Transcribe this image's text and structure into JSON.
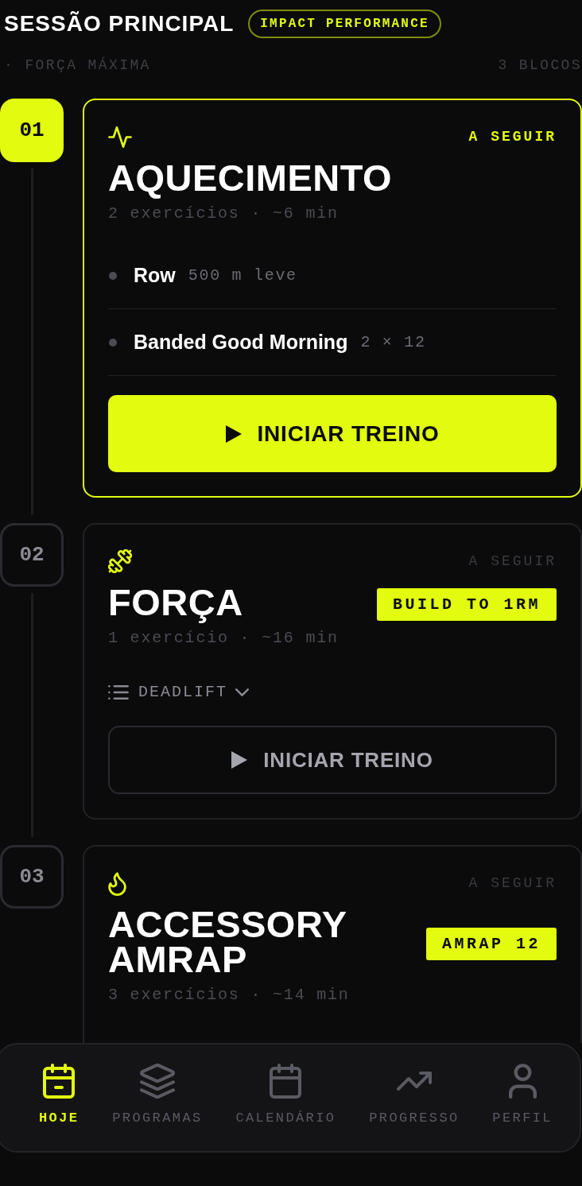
{
  "header": {
    "title": "SESSÃO PRINCIPAL",
    "chip": "IMPACT PERFORMANCE",
    "focus": "· FORÇA MÁXIMA",
    "block_count": "3 BLOCOS"
  },
  "blocks": [
    {
      "number": "01",
      "active": true,
      "status": "A SEGUIR",
      "title": "AQUECIMENTO",
      "meta": "2 exercícios · ~6 min",
      "exercises": [
        {
          "name": "Row",
          "detail": "500 m leve"
        },
        {
          "name": "Banded Good Morning",
          "detail": "2 × 12"
        }
      ],
      "button": "INICIAR TREINO"
    },
    {
      "number": "02",
      "active": false,
      "status": "A SEGUIR",
      "title": "FORÇA",
      "tag": "BUILD TO 1RM",
      "meta": "1 exercício · ~16 min",
      "exercise_toggle": {
        "label": "DEADLIFT",
        "expanded": false
      },
      "button": "INICIAR TREINO"
    },
    {
      "number": "03",
      "active": false,
      "status": "A SEGUIR",
      "title": "ACCESSORY AMRAP",
      "tag": "AMRAP 12",
      "meta": "3 exercícios · ~14 min"
    }
  ],
  "nav": [
    {
      "label": "HOJE",
      "selected": true
    },
    {
      "label": "PROGRAMAS",
      "selected": false
    },
    {
      "label": "CALENDÁRIO",
      "selected": false
    },
    {
      "label": "PROGRESSO",
      "selected": false
    },
    {
      "label": "PERFIL",
      "selected": false
    }
  ]
}
